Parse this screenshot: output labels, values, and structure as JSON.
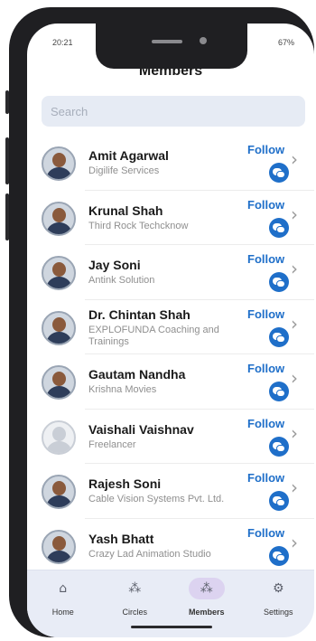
{
  "status_bar": {
    "time": "20:21",
    "battery": "67%"
  },
  "title": "Members",
  "search": {
    "placeholder": "Search",
    "value": ""
  },
  "members": [
    {
      "name": "Amit Agarwal",
      "company": "Digilife Services",
      "follow_label": "Follow",
      "avatar": "photo"
    },
    {
      "name": "Krunal Shah",
      "company": "Third Rock Techcknow",
      "follow_label": "Follow",
      "avatar": "photo"
    },
    {
      "name": "Jay Soni",
      "company": "Antink Solution",
      "follow_label": "Follow",
      "avatar": "photo"
    },
    {
      "name": "Dr. Chintan Shah",
      "company": "EXPLOFUNDA Coaching and Trainings",
      "follow_label": "Follow",
      "avatar": "photo"
    },
    {
      "name": "Gautam Nandha",
      "company": "Krishna Movies",
      "follow_label": "Follow",
      "avatar": "photo"
    },
    {
      "name": "Vaishali Vaishnav",
      "company": "Freelancer",
      "follow_label": "Follow",
      "avatar": "placeholder"
    },
    {
      "name": "Rajesh Soni",
      "company": "Cable Vision Systems Pvt. Ltd.",
      "follow_label": "Follow",
      "avatar": "photo"
    },
    {
      "name": "Yash Bhatt",
      "company": "Crazy Lad Animation Studio",
      "follow_label": "Follow",
      "avatar": "photo"
    }
  ],
  "tabs": [
    {
      "label": "Home",
      "icon": "home-icon",
      "active": false
    },
    {
      "label": "Circles",
      "icon": "circles-icon",
      "active": false
    },
    {
      "label": "Members",
      "icon": "members-icon",
      "active": true
    },
    {
      "label": "Settings",
      "icon": "gear-icon",
      "active": false
    }
  ],
  "colors": {
    "accent": "#1f6fc9",
    "tab_bar": "#e8ecf6",
    "active_pill": "#dcd3f0",
    "search_bg": "#e6ebf4"
  }
}
